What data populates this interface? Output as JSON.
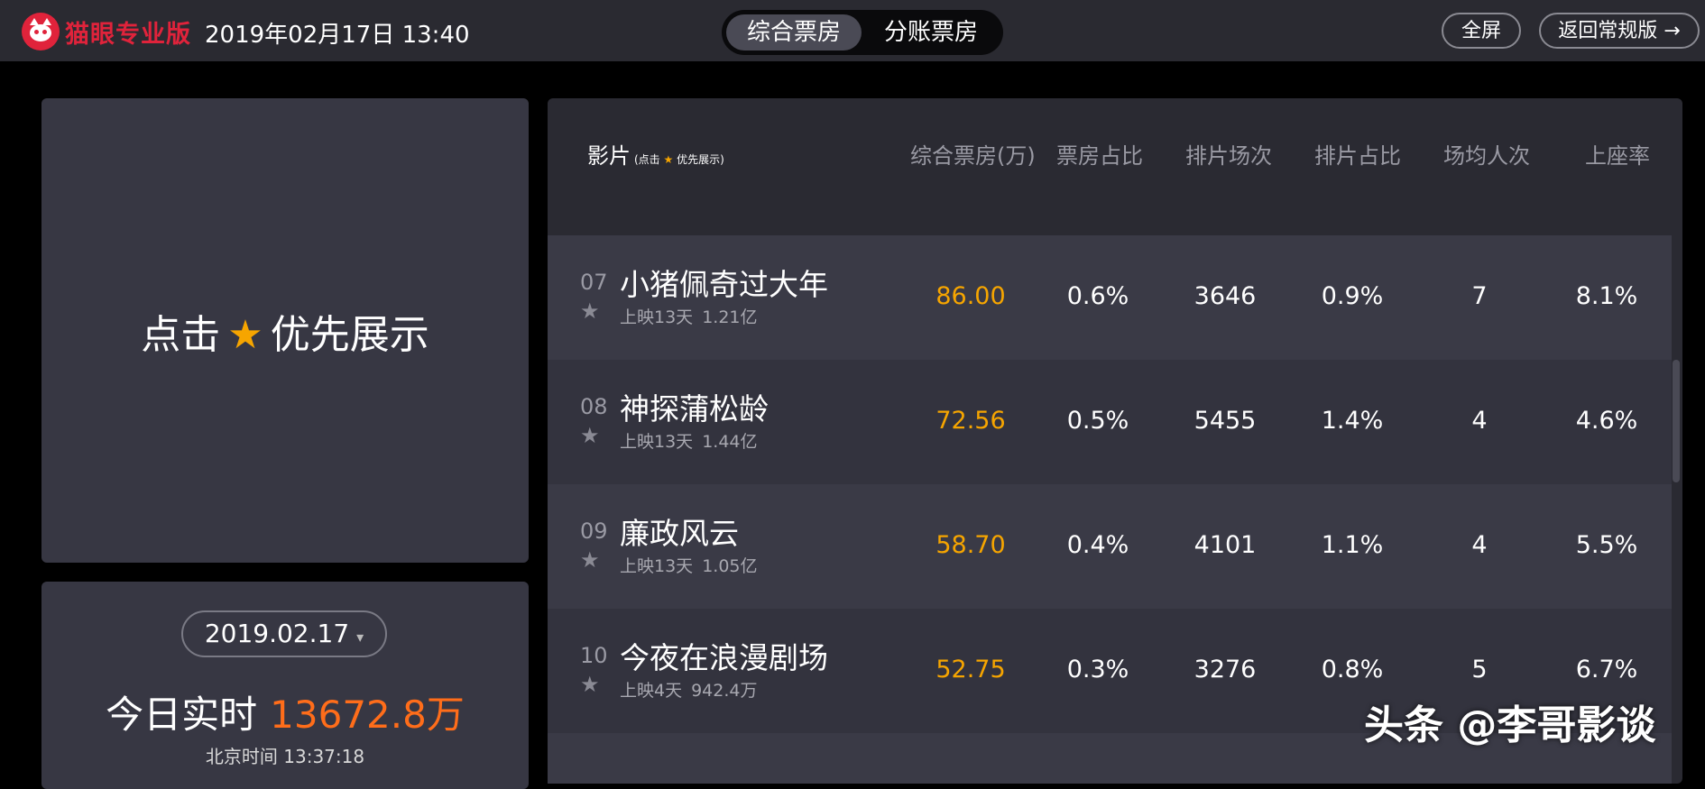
{
  "topbar": {
    "logo_text": "猫眼专业版",
    "datetime": "2019年02月17日 13:40",
    "tabs": [
      {
        "label": "综合票房",
        "active": true
      },
      {
        "label": "分账票房",
        "active": false
      }
    ],
    "fullscreen_label": "全屏",
    "back_label": "返回常规版 →"
  },
  "prompt": {
    "before": "点击",
    "star_icon": "star-icon",
    "after": "优先展示"
  },
  "stats": {
    "date": "2019.02.17",
    "caret": "▾",
    "realtime_label": "今日实时",
    "realtime_amount": "13672.8万",
    "beijing_time": "北京时间 13:37:18"
  },
  "table": {
    "headers": {
      "film": "影片",
      "film_hint_before": "(点击",
      "film_hint_after": "优先展示)",
      "box_office": "综合票房(万)",
      "bo_share": "票房占比",
      "screenings": "排片场次",
      "screening_share": "排片占比",
      "avg_per_show": "场均人次",
      "occupancy": "上座率"
    },
    "rows": [
      {
        "rank": "07",
        "title": "小猪佩奇过大年",
        "days": "上映13天",
        "gross": "1.21亿",
        "box_office": "86.00",
        "bo_share": "0.6%",
        "screenings": "3646",
        "screening_share": "0.9%",
        "avg_per_show": "7",
        "occupancy": "8.1%"
      },
      {
        "rank": "08",
        "title": "神探蒲松龄",
        "days": "上映13天",
        "gross": "1.44亿",
        "box_office": "72.56",
        "bo_share": "0.5%",
        "screenings": "5455",
        "screening_share": "1.4%",
        "avg_per_show": "4",
        "occupancy": "4.6%"
      },
      {
        "rank": "09",
        "title": "廉政风云",
        "days": "上映13天",
        "gross": "1.05亿",
        "box_office": "58.70",
        "bo_share": "0.4%",
        "screenings": "4101",
        "screening_share": "1.1%",
        "avg_per_show": "4",
        "occupancy": "5.5%"
      },
      {
        "rank": "10",
        "title": "今夜在浪漫剧场",
        "days": "上映4天",
        "gross": "942.4万",
        "box_office": "52.75",
        "bo_share": "0.3%",
        "screenings": "3276",
        "screening_share": "0.8%",
        "avg_per_show": "5",
        "occupancy": "6.7%"
      }
    ]
  },
  "watermark": "头条 @李哥影谈",
  "colors": {
    "brand_red": "#e0233b",
    "accent_orange": "#f6a500",
    "realtime_orange": "#ff6d1a"
  }
}
